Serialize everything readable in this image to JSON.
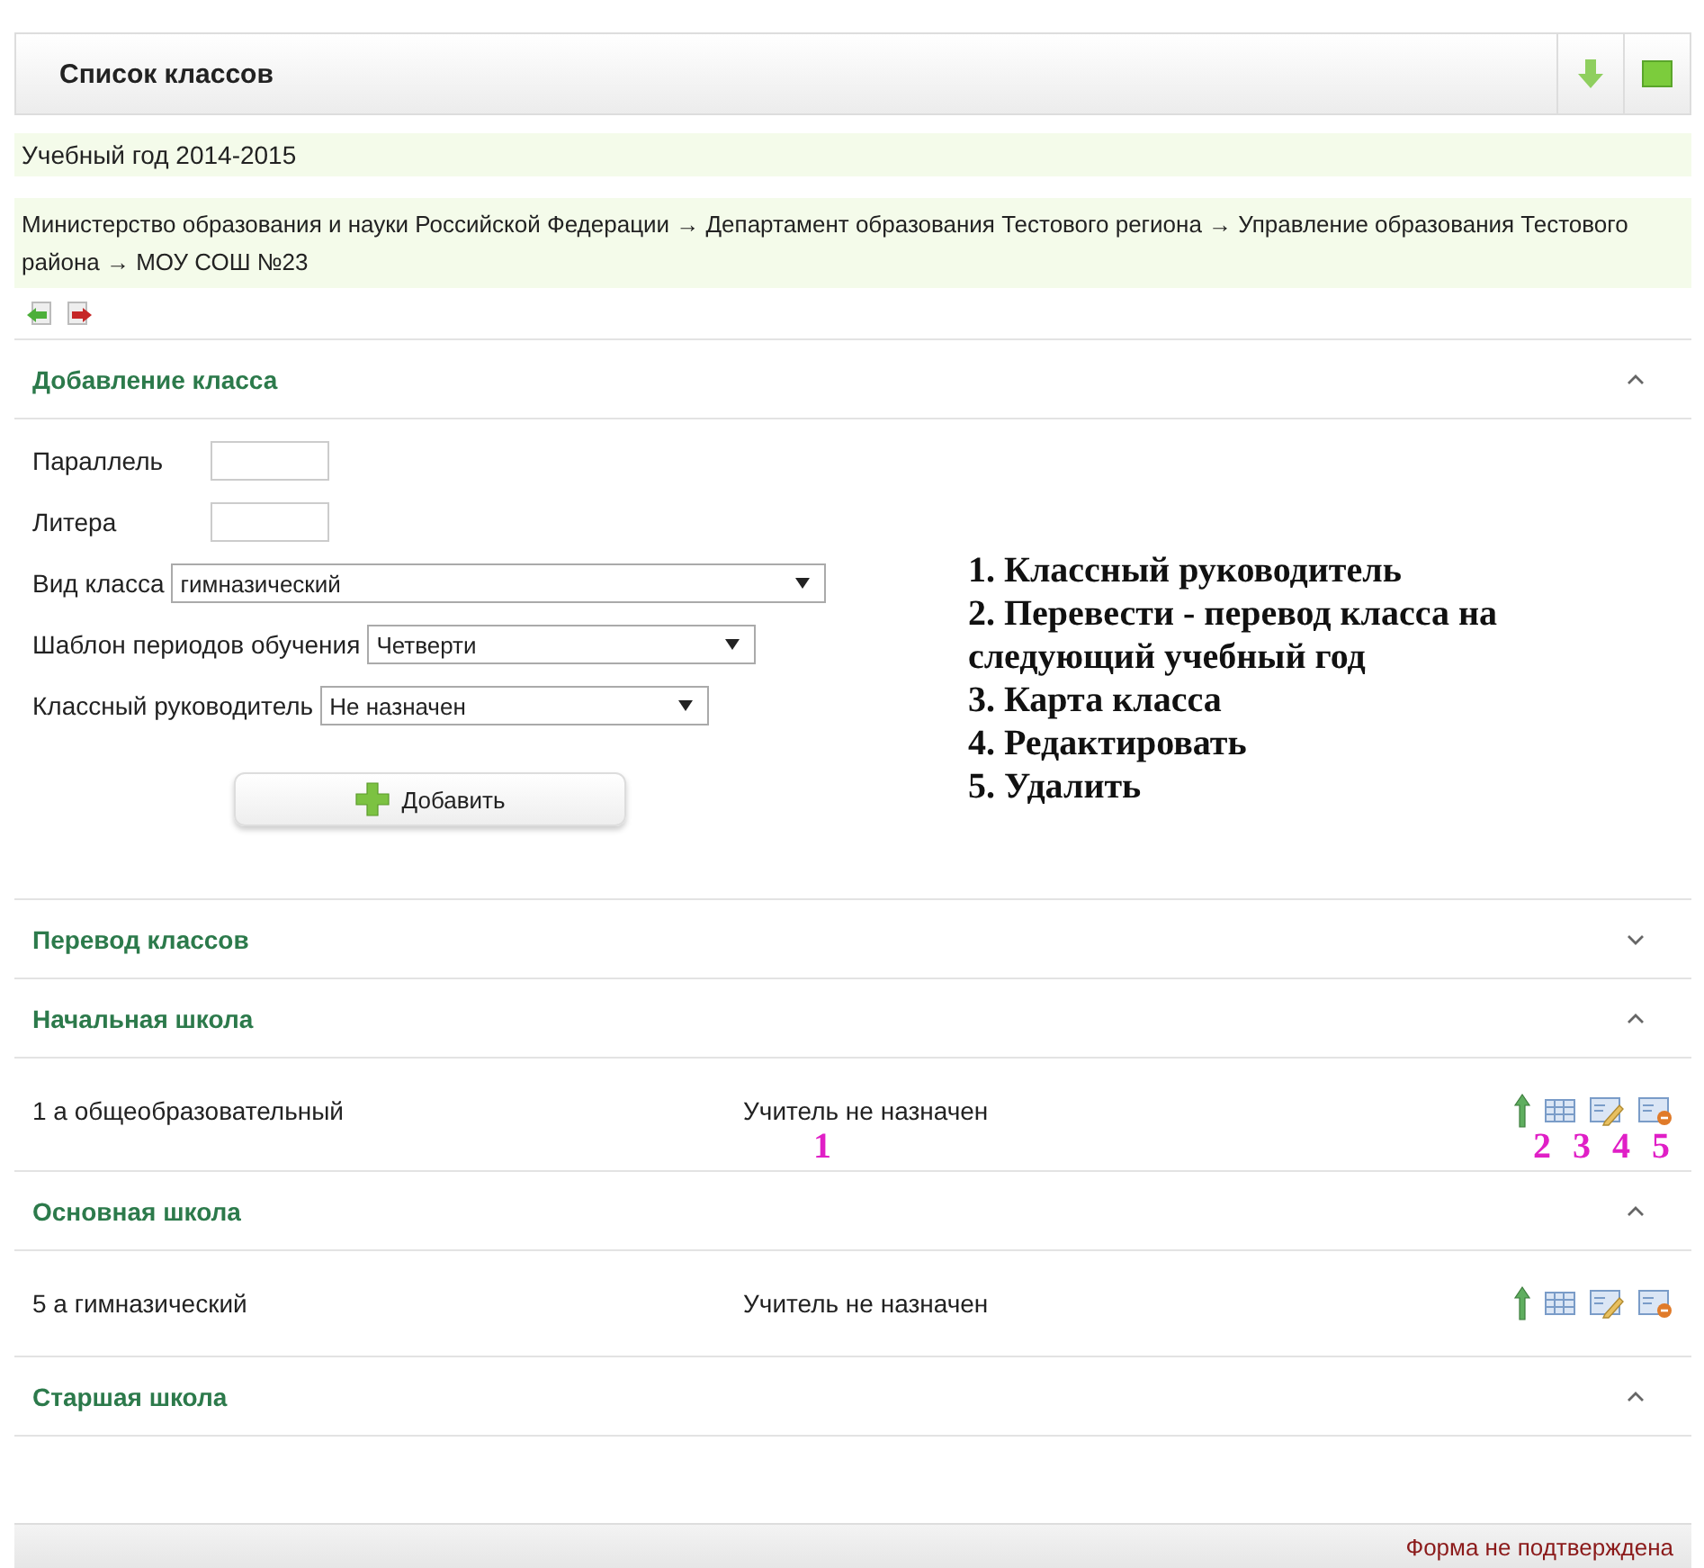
{
  "panel": {
    "title": "Список классов"
  },
  "school_year": "Учебный год 2014-2015",
  "breadcrumb": "Министерство образования и науки Российской Федерации → Департамент образования Тестового региона → Управление образования Тестового района → МОУ СОШ №23",
  "sections": [
    {
      "kind": "form",
      "title": "Добавление класса",
      "expanded": true,
      "fields": [
        {
          "kind": "text",
          "label": "Параллель"
        },
        {
          "kind": "text",
          "label": "Литера"
        },
        {
          "kind": "select",
          "label": "Вид класса",
          "value": "гимназический"
        },
        {
          "kind": "select",
          "label": "Шаблон периодов обучения",
          "value": "Четверти"
        },
        {
          "kind": "select",
          "label": "Классный руководитель",
          "value": "Не назначен"
        }
      ],
      "button": "Добавить",
      "annotation": [
        "1. Классный руководитель",
        "2. Перевести - перевод класса на следующий учебный год",
        "3. Карта класса",
        "4. Редактировать",
        "5. Удалить"
      ]
    },
    {
      "title": "Перевод классов",
      "expanded": false
    },
    {
      "kind": "classes",
      "title": "Начальная школа",
      "expanded": true,
      "rows": [
        {
          "name": "1 а общеобразовательный",
          "teacher": "Учитель не назначен",
          "markers": {
            "teacher": "1",
            "actions": [
              "2",
              "3",
              "4",
              "5"
            ]
          }
        }
      ]
    },
    {
      "kind": "classes",
      "title": "Основная школа",
      "expanded": true,
      "rows": [
        {
          "name": "5 а гимназический",
          "teacher": "Учитель не назначен"
        }
      ]
    },
    {
      "kind": "classes",
      "title": "Старшая школа",
      "expanded": true
    }
  ],
  "status_bar": "Форма не подтверждена"
}
